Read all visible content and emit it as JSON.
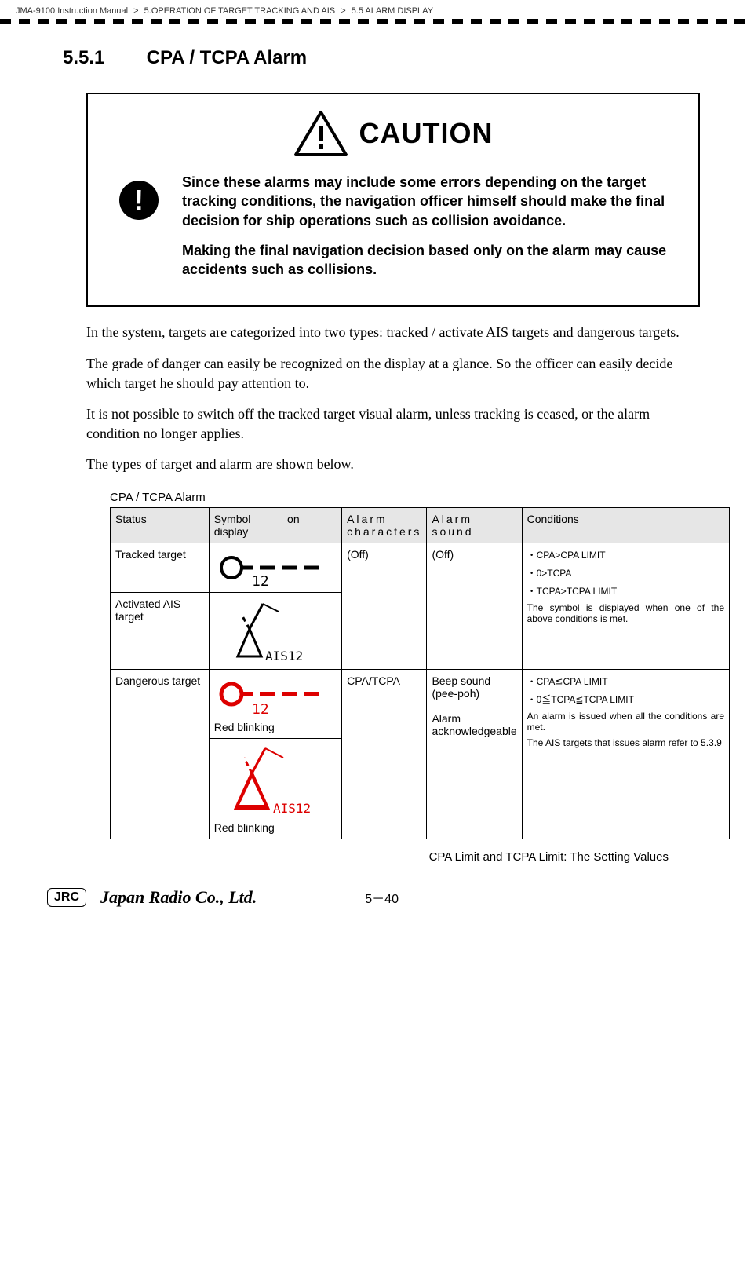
{
  "header": {
    "manual": "JMA-9100 Instruction Manual",
    "sep1": ">",
    "chapter": "5.OPERATION OF TARGET TRACKING AND AIS",
    "sep2": ">",
    "section": "5.5  ALARM DISPLAY"
  },
  "title": {
    "num": "5.5.1",
    "text": "CPA / TCPA Alarm"
  },
  "caution": {
    "word": "CAUTION",
    "p1": "Since these alarms may include some errors depending on the target tracking conditions, the navigation officer himself should make the final decision for ship operations such as collision avoidance.",
    "p2": "Making the final navigation decision based only on the alarm may cause accidents such as collisions."
  },
  "paras": {
    "p1": "In the system, targets are categorized into two types: tracked / activate AIS targets and dangerous targets.",
    "p2": "The grade of danger can easily be recognized on the display at a glance. So the officer can easily decide which target he should pay attention to.",
    "p3": "It is not possible to switch off the tracked target visual alarm, unless tracking is ceased, or the alarm condition no longer applies.",
    "p4": "The types of target and alarm are shown below."
  },
  "table": {
    "title": "CPA / TCPA Alarm",
    "headers": {
      "status": "Status",
      "symbol": "Symbol on display",
      "chars": "Alarm characters",
      "sound": "Alarm sound",
      "cond": "Conditions"
    },
    "rows": {
      "tracked": {
        "status": "Tracked target",
        "symbol_label": "12"
      },
      "activated": {
        "status": "Activated AIS target",
        "symbol_label": "AIS12"
      },
      "off_chars": "(Off)",
      "off_sound": "(Off)",
      "cond1": {
        "l1": "・CPA>CPA LIMIT",
        "l2": "・0>TCPA",
        "l3": "・TCPA>TCPA LIMIT",
        "l4": "The symbol is displayed when one of the above conditions is met."
      },
      "dangerous": {
        "status": "Dangerous target",
        "symbol_label1": "12",
        "caption1": "Red blinking",
        "symbol_label2": "AIS12",
        "caption2": "Red blinking"
      },
      "danger_chars": "CPA/TCPA",
      "danger_sound": "Beep sound (pee-poh)\n\nAlarm acknowledgeable",
      "cond2": {
        "l1": "・CPA≦CPA LIMIT",
        "l2": "・0≦TCPA≦TCPA LIMIT",
        "l3": "An alarm is issued when all the conditions are met.",
        "l4": "The AIS targets that issues alarm refer to 5.3.9"
      }
    }
  },
  "footnote": "CPA Limit and TCPA Limit: The Setting Values",
  "footer": {
    "jrc": "JRC",
    "company": "Japan Radio Co., Ltd.",
    "page": "5－40"
  }
}
